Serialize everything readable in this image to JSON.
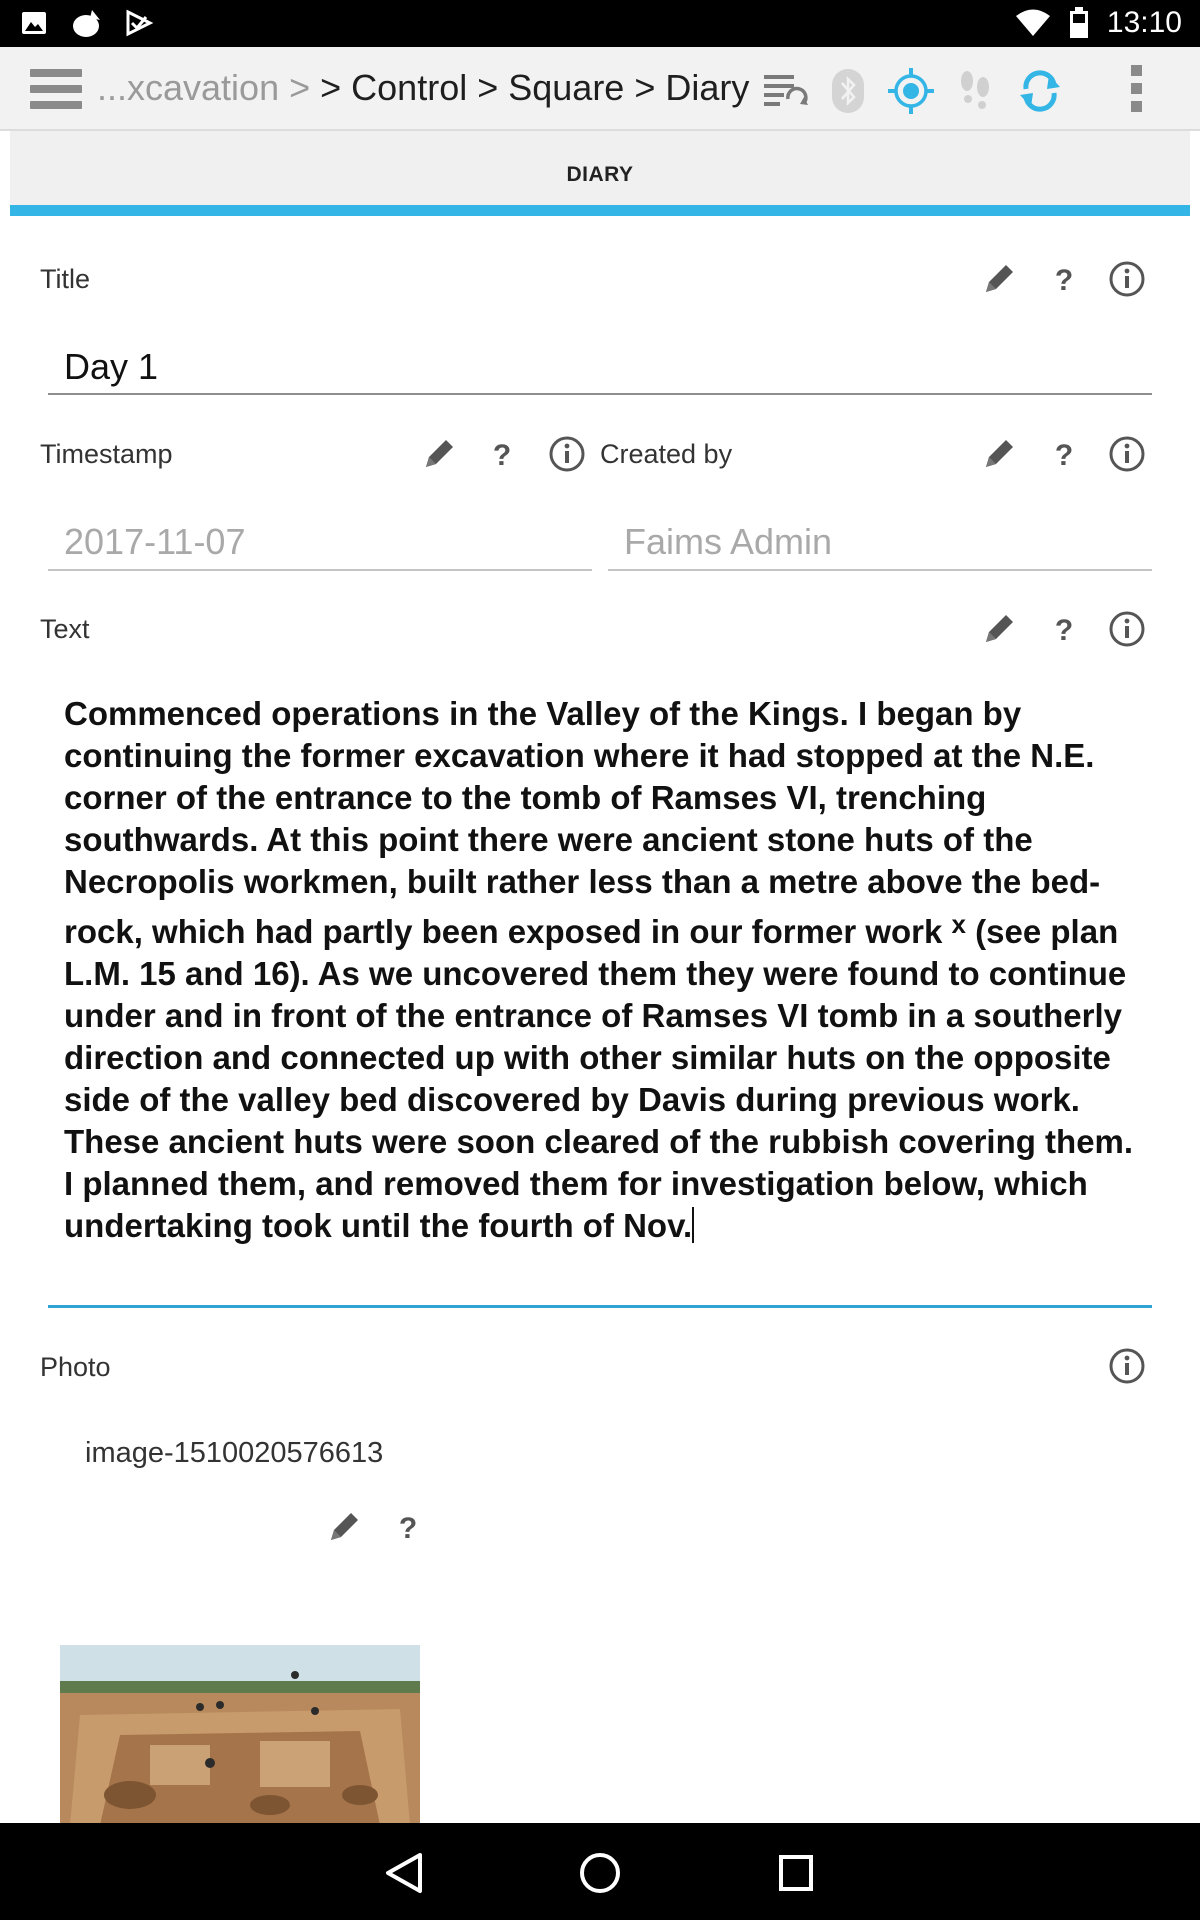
{
  "status_bar": {
    "time": "13:10",
    "left_icons": [
      "image-notification-icon",
      "cat-app-notification-icon",
      "download-done-notification-icon"
    ],
    "right_icons": [
      "wifi-icon",
      "battery-icon"
    ]
  },
  "toolbar": {
    "breadcrumb_faded": "...xcavation >",
    "breadcrumb_main": "> Control > Square > Diary",
    "icons": [
      "sync-settings-icon",
      "bluetooth-icon",
      "gps-icon",
      "tracking-footsteps-icon",
      "refresh-icon",
      "overflow-menu-icon"
    ],
    "accent_color": "#33b5e5"
  },
  "tab": {
    "label": "DIARY"
  },
  "form": {
    "title": {
      "label": "Title",
      "value": "Day 1"
    },
    "timestamp": {
      "label": "Timestamp",
      "value": "2017-11-07"
    },
    "created_by": {
      "label": "Created by",
      "value": "Faims Admin"
    },
    "text": {
      "label": "Text",
      "value_part1": "Commenced operations in the Valley of the Kings. I began by continuing the former excavation where it had stopped at the N.E. corner of the entrance to the tomb of Ramses VI, trenching southwards. At this point there were ancient stone huts of the Necropolis workmen, built rather less than a metre above the bed-rock, which had partly been exposed in our former work ",
      "superscript": "x",
      "value_part2": " (see plan L.M. 15 and 16). As we uncovered them they were found to continue under and in front of the entrance of Ramses VI tomb in a southerly direction and connected up with other similar huts on the opposite side of the valley bed discovered by Davis during previous work. These ancient huts were soon cleared of the rubbish covering them. I planned them, and removed them for investigation below, which undertaking took until the fourth of Nov."
    },
    "photo": {
      "label": "Photo",
      "file_name": "image-1510020576613"
    }
  },
  "icons": {
    "edit": "pencil-icon",
    "help": "question-mark-icon",
    "info": "info-icon"
  },
  "nav_bar": {
    "icons": [
      "back-icon",
      "home-icon",
      "recents-icon"
    ]
  }
}
